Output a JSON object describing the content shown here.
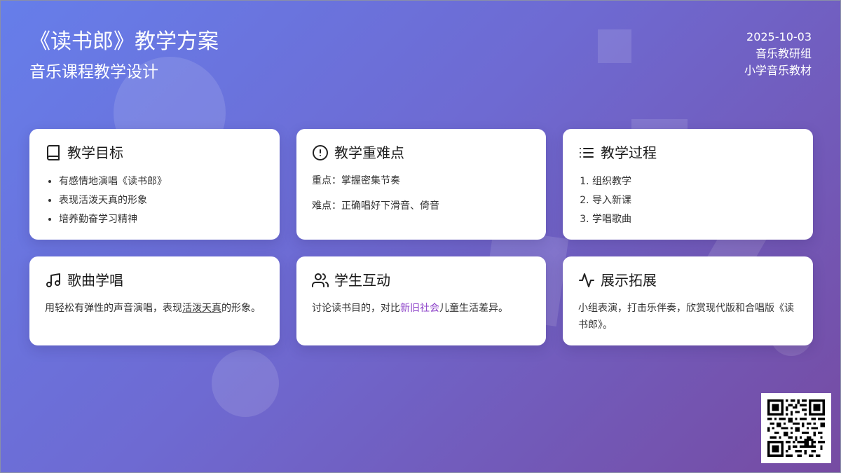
{
  "header": {
    "title": "《读书郎》教学方案",
    "subtitle": "音乐课程教学设计"
  },
  "meta": {
    "date": "2025-10-03",
    "group": "音乐教研组",
    "material": "小学音乐教材"
  },
  "cards": {
    "goals": {
      "title": "教学目标",
      "icon": "book-icon",
      "items": [
        "有感情地演唱《读书郎》",
        "表现活泼天真的形象",
        "培养勤奋学习精神"
      ]
    },
    "keypoints": {
      "title": "教学重难点",
      "icon": "alert-circle-icon",
      "key": "重点：掌握密集节奏",
      "difficulty": "难点：正确唱好下滑音、倚音"
    },
    "process": {
      "title": "教学过程",
      "icon": "list-icon",
      "items": [
        "组织教学",
        "导入新课",
        "学唱歌曲"
      ]
    },
    "singing": {
      "title": "歌曲学唱",
      "icon": "music-icon",
      "text_before": "用轻松有弹性的声音演唱，表现",
      "text_underlined": "活泼天真",
      "text_after": "的形象。"
    },
    "interaction": {
      "title": "学生互动",
      "icon": "users-icon",
      "text_before": "讨论读书目的，对比",
      "text_highlight": "新旧社会",
      "text_after": "儿童生活差异。"
    },
    "extension": {
      "title": "展示拓展",
      "icon": "activity-icon",
      "text": "小组表演，打击乐伴奏，欣赏现代版和合唱版《读书郎》。"
    }
  },
  "colors": {
    "gradient_start": "#667eea",
    "gradient_end": "#764ba2",
    "highlight": "#8e44c9"
  }
}
